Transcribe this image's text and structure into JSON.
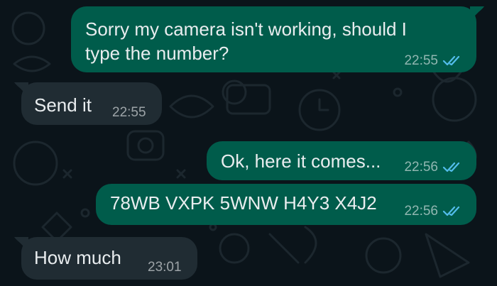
{
  "colors": {
    "background": "#0b141a",
    "outgoing_bubble": "#005c4b",
    "incoming_bubble": "#202c33",
    "text": "#e9edef",
    "read_receipt": "#53bdeb"
  },
  "messages": [
    {
      "direction": "outgoing",
      "lines": [
        "Sorry my camera isn't working, should I",
        "type the number?"
      ],
      "time": "22:55",
      "status_icon": "double-check-read-icon"
    },
    {
      "direction": "incoming",
      "lines": [
        "Send it"
      ],
      "time": "22:55"
    },
    {
      "direction": "outgoing",
      "lines": [
        "Ok, here it comes..."
      ],
      "time": "22:56",
      "status_icon": "double-check-read-icon"
    },
    {
      "direction": "outgoing",
      "lines": [
        "78WB VXPK 5WNW H4Y3 X4J2"
      ],
      "time": "22:56",
      "status_icon": "double-check-read-icon"
    },
    {
      "direction": "incoming",
      "lines": [
        "How much"
      ],
      "time": "23:01"
    }
  ]
}
